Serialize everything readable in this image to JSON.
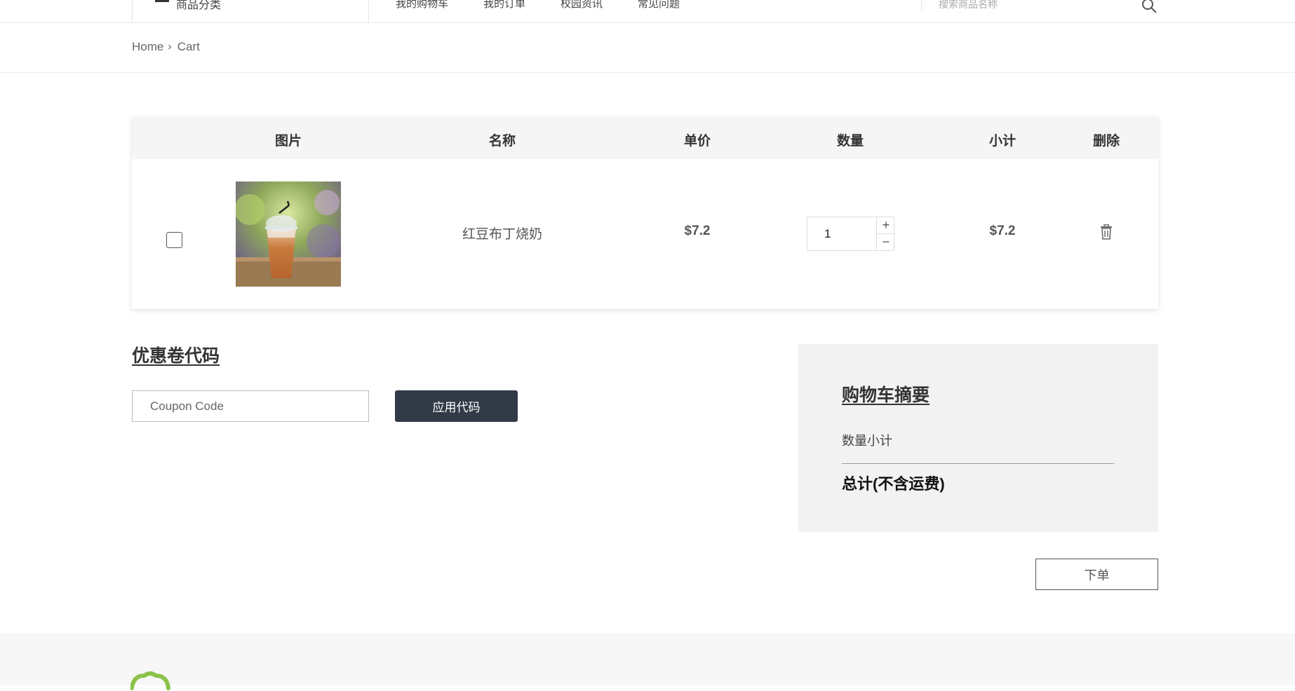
{
  "topnav": {
    "category_label": "商品分类",
    "links": [
      "我的购物车",
      "我的订单",
      "校园资讯",
      "常见问题"
    ],
    "search_placeholder": "搜索商品名称"
  },
  "breadcrumb": {
    "home": "Home",
    "current": "Cart"
  },
  "cart": {
    "headers": {
      "image": "图片",
      "name": "名称",
      "price": "单价",
      "quantity": "数量",
      "subtotal": "小计",
      "delete": "删除"
    },
    "item": {
      "name": "红豆布丁烧奶",
      "price": "$7.2",
      "quantity": "1",
      "subtotal": "$7.2",
      "checked": false
    },
    "qty_plus": "+",
    "qty_minus": "−"
  },
  "coupon": {
    "title": "优惠卷代码",
    "placeholder": "Coupon Code",
    "apply_label": "应用代码"
  },
  "summary": {
    "title": "购物车摘要",
    "quantity_subtotal": "数量小计",
    "total": "总计(不含运费)"
  },
  "order_button": "下单",
  "colors": {
    "dark_button": "#333a47",
    "summary_bg": "#f2f2f2",
    "header_bg": "#f5f5f5",
    "logo_green": "#8bc34a"
  },
  "icons": {
    "menu": "hamburger-icon",
    "search": "search-icon",
    "delete": "trash-icon"
  }
}
